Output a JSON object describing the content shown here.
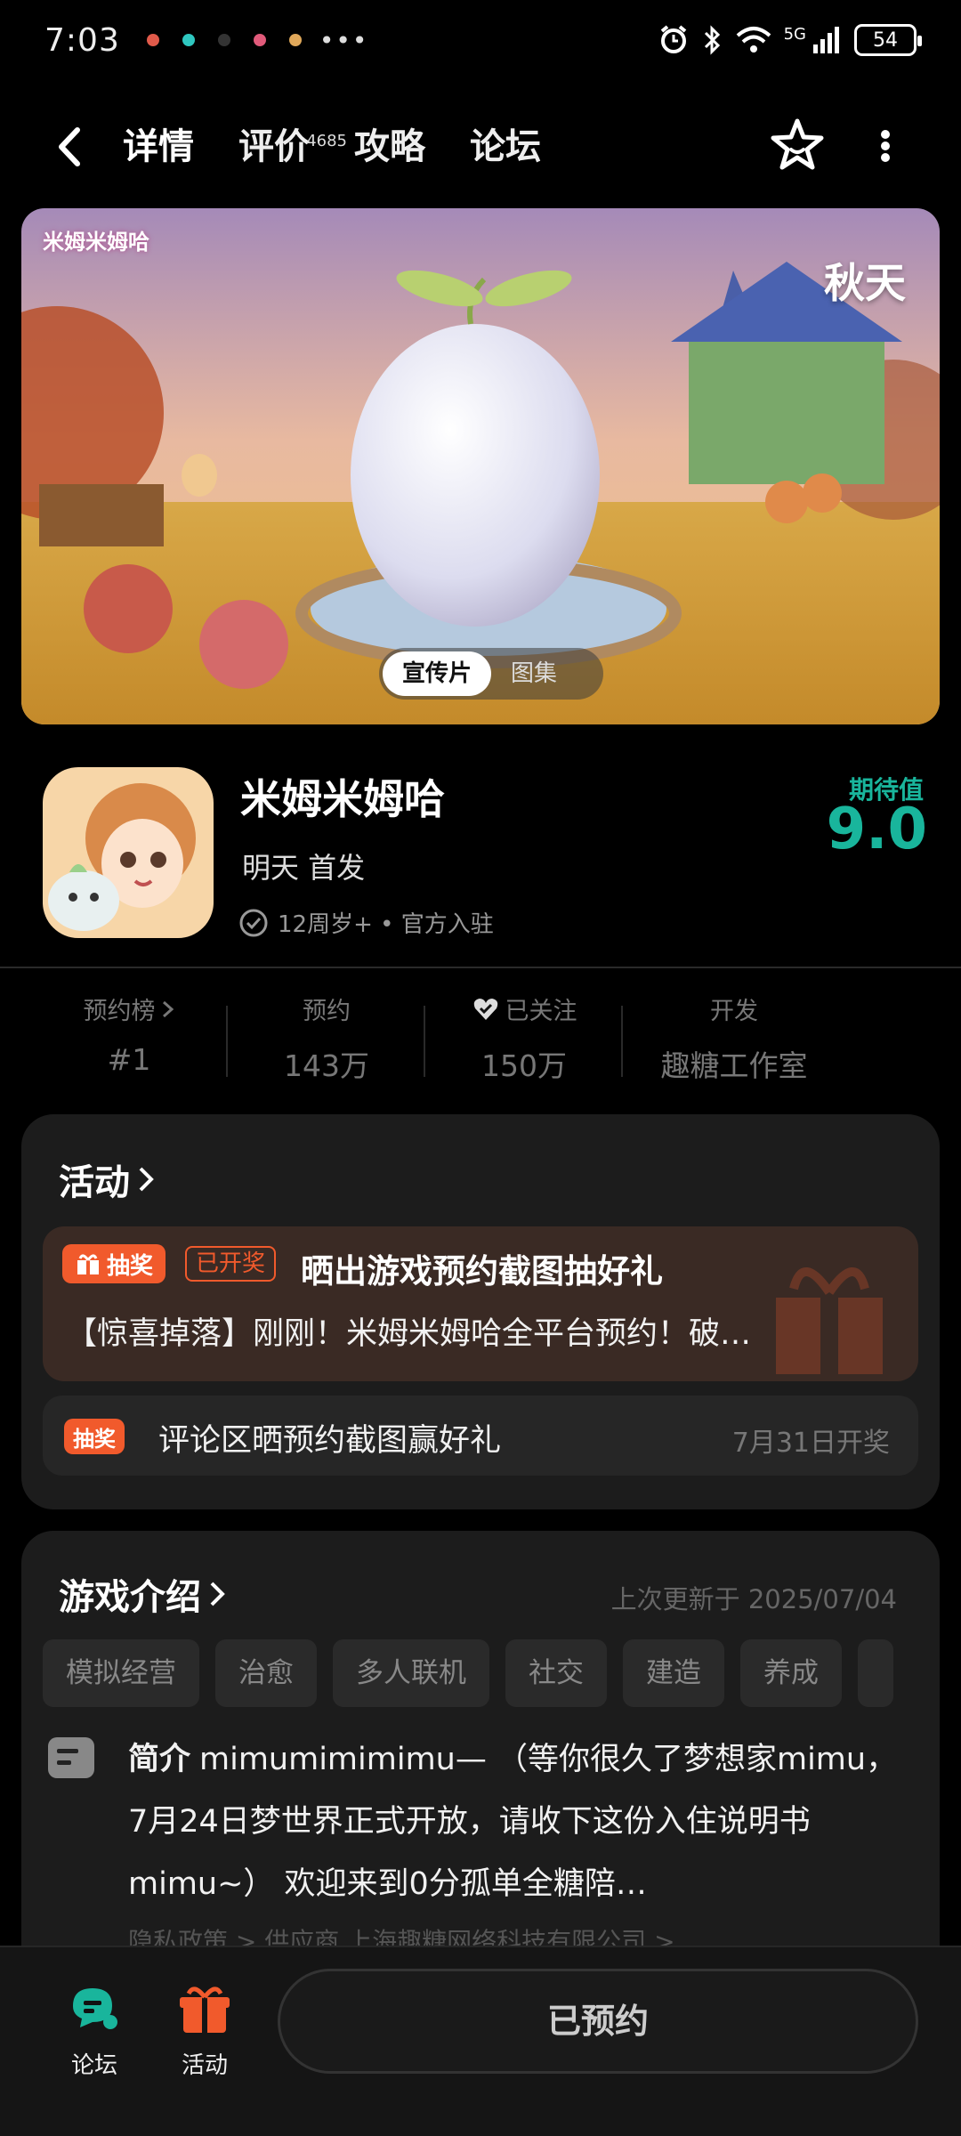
{
  "status_bar": {
    "time": "7:03",
    "more": "•••",
    "network": "5G",
    "battery": "54"
  },
  "nav": {
    "tabs": [
      {
        "label": "详情"
      },
      {
        "label": "评价",
        "count": "4685"
      },
      {
        "label": "攻略"
      },
      {
        "label": "论坛"
      }
    ]
  },
  "banner": {
    "logo_left": "米姆米姆哈",
    "logo_right": "秋天",
    "media_tabs": [
      "宣传片",
      "图集"
    ]
  },
  "game": {
    "title": "米姆米姆哈",
    "subtitle": "明天 首发",
    "tags": "12周岁+ • 官方入驻",
    "expect_label": "期待值",
    "expect_score": "9.0"
  },
  "stats": [
    {
      "label": "预约榜",
      "value": "#1"
    },
    {
      "label": "预约",
      "value": "143万"
    },
    {
      "label": "已关注",
      "value": "150万"
    },
    {
      "label": "开发",
      "value": "趣糖工作室"
    }
  ],
  "activities": {
    "title": "活动",
    "promo": {
      "badge": "抽奖",
      "status": "已开奖",
      "title": "晒出游戏预约截图抽好礼",
      "desc": "【惊喜掉落】刚刚！米姆米姆哈全平台预约！破…"
    },
    "event2": {
      "badge": "抽奖",
      "title": "评论区晒预约截图赢好礼",
      "date": "7月31日开奖"
    }
  },
  "intro": {
    "title": "游戏介绍",
    "updated": "上次更新于 2025/07/04",
    "chips": [
      "模拟经营",
      "治愈",
      "多人联机",
      "社交",
      "建造",
      "养成"
    ],
    "desc_head": "简介",
    "desc": "mimumimimimu— （等你很久了梦想家mimu，7月24日梦世界正式开放，请收下这份入住说明书mimu~） 欢迎来到0分孤单全糖陪…",
    "links": "隐私政策 >  供应商 上海趣糖网络科技有限公司 >"
  },
  "bottom": {
    "forum": "论坛",
    "activity": "活动",
    "reserve": "已预约"
  },
  "colors": {
    "accent": "#19b59c",
    "lottery": "#f15a2c"
  }
}
